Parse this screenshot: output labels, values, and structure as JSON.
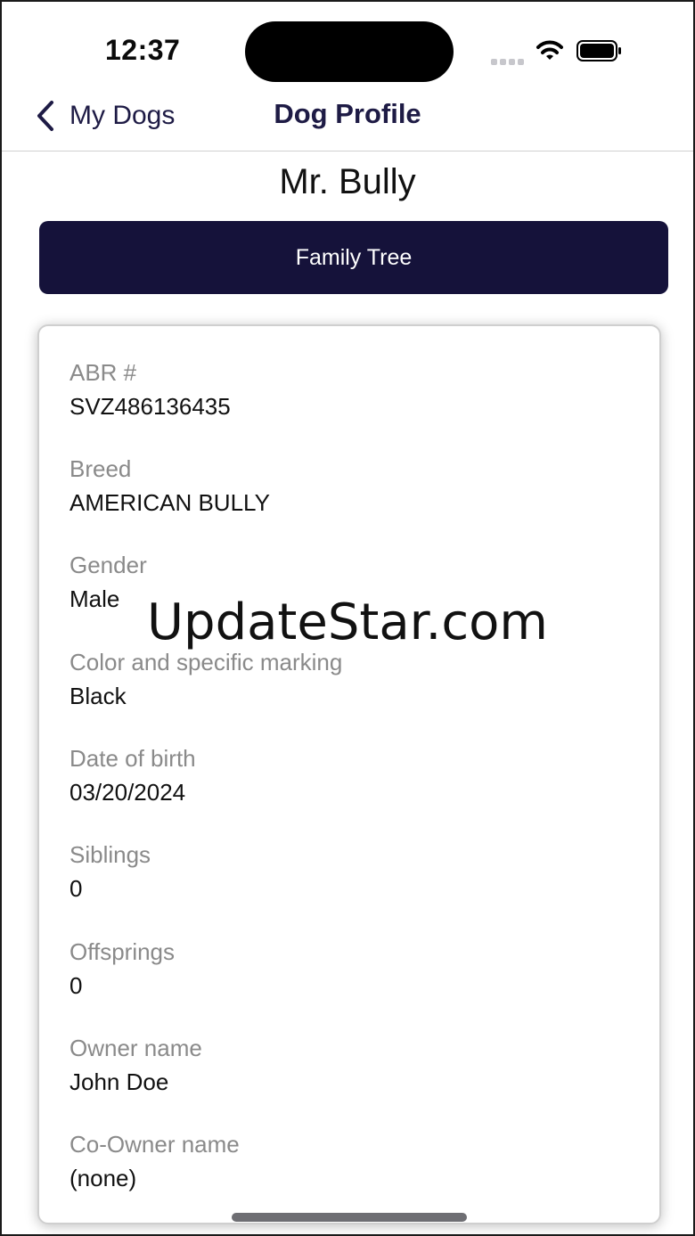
{
  "status_bar": {
    "time": "12:37"
  },
  "nav": {
    "back_label": "My Dogs",
    "title": "Dog Profile"
  },
  "dog": {
    "name": "Mr. Bully"
  },
  "actions": {
    "family_tree_label": "Family Tree"
  },
  "details": [
    {
      "label": "ABR #",
      "value": "SVZ486136435"
    },
    {
      "label": "Breed",
      "value": "AMERICAN BULLY"
    },
    {
      "label": "Gender",
      "value": "Male"
    },
    {
      "label": "Color and specific marking",
      "value": "Black"
    },
    {
      "label": "Date of birth",
      "value": "03/20/2024"
    },
    {
      "label": "Siblings",
      "value": "0"
    },
    {
      "label": "Offsprings",
      "value": "0"
    },
    {
      "label": "Owner name",
      "value": "John Doe"
    },
    {
      "label": "Co-Owner name",
      "value": "(none)"
    }
  ],
  "watermark": "UpdateStar.com",
  "colors": {
    "primary": "#15123a",
    "nav_text": "#1e1b45",
    "label_gray": "#8a8a8a"
  },
  "icons": {
    "back": "chevron-left-icon",
    "wifi": "wifi-icon",
    "battery": "battery-icon",
    "signal": "signal-icon"
  }
}
